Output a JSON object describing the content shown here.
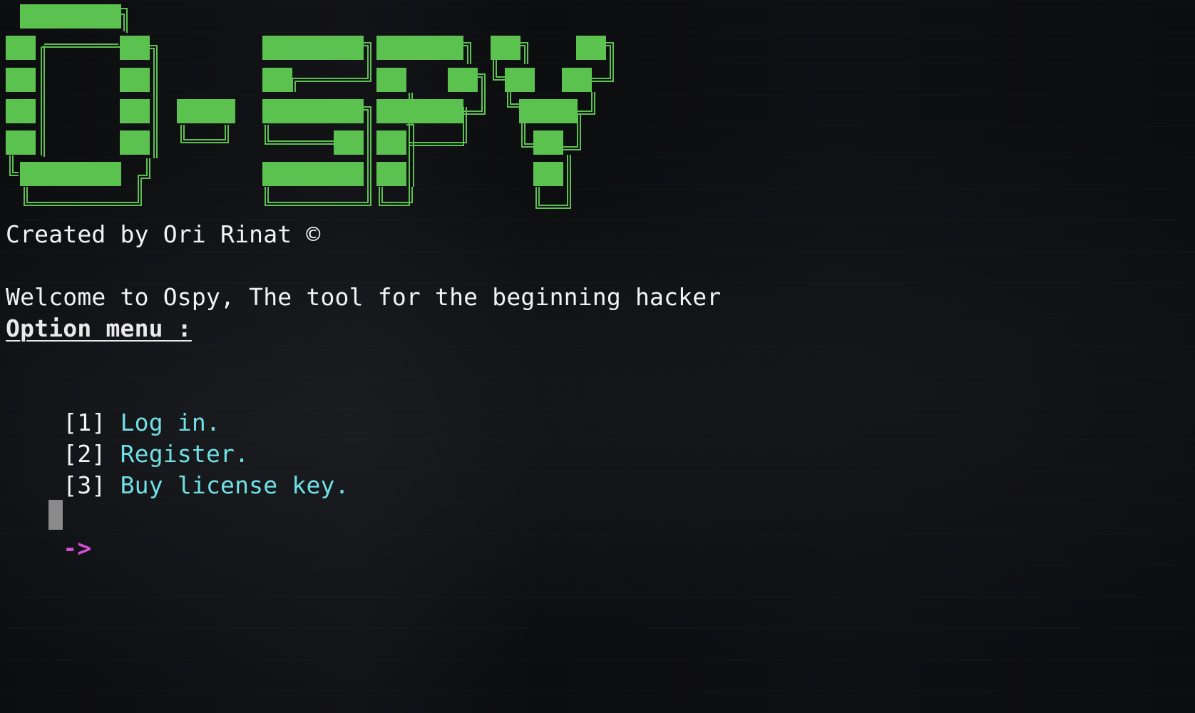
{
  "app": {
    "logo_text": "O-SPY"
  },
  "terminal": {
    "credit": "Created by Ori Rinat ©",
    "welcome": "Welcome to Ospy, The tool for the beginning hacker",
    "menu_title": "Option menu :",
    "options": [
      {
        "number": "[1]",
        "label": "Log in."
      },
      {
        "number": "[2]",
        "label": "Register."
      },
      {
        "number": "[3]",
        "label": "Buy license key."
      }
    ],
    "prompt": "->",
    "input_value": ""
  },
  "colors": {
    "logo_fill": "#5cc24f",
    "logo_outline": "#5cc24f",
    "text": "#f2f2f2",
    "option_text": "#6fe0e6",
    "prompt": "#d24fd6",
    "cursor": "#8a8a8a",
    "background": "#0b0c0e"
  }
}
